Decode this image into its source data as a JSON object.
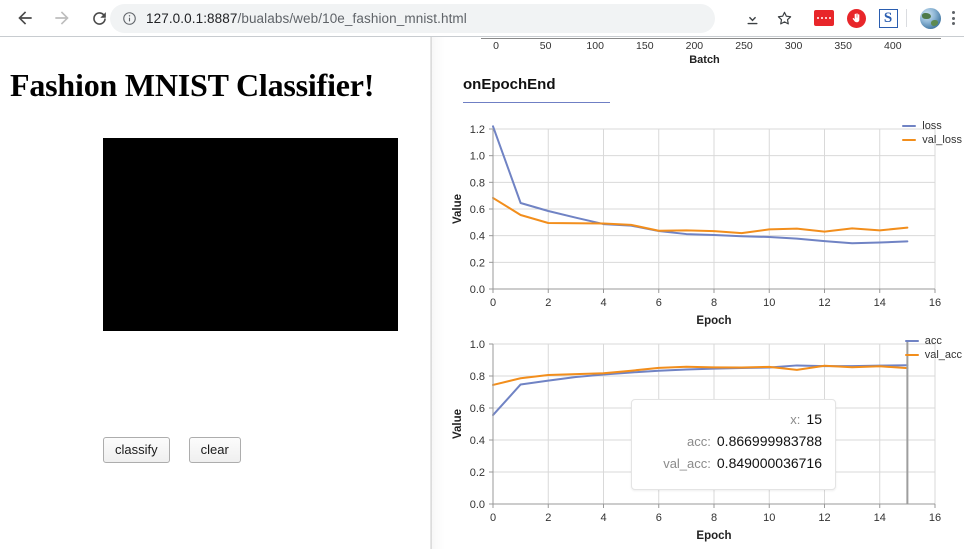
{
  "browser": {
    "back_label": "Back",
    "forward_label": "Forward",
    "reload_label": "Reload",
    "omnibox": {
      "host": "127.0.0.1:8887",
      "path": "/bualabs/web/10e_fashion_mnist.html",
      "info_icon": "info-circle-icon"
    },
    "toolbar_icons": [
      {
        "name": "download-icon",
        "label": "Downloads"
      },
      {
        "name": "star-icon",
        "label": "Bookmark this tab"
      },
      {
        "name": "extension-red-badge-icon",
        "label": "Extension"
      },
      {
        "name": "stop-hand-icon",
        "label": "Extension"
      },
      {
        "name": "blue-s-icon",
        "label": "Extension",
        "glyph": "S"
      },
      {
        "name": "avatar-globe-icon",
        "label": "Profile"
      },
      {
        "name": "kebab-menu-icon",
        "label": "Customize and control"
      }
    ]
  },
  "page": {
    "title": "Fashion MNIST Classifier!",
    "canvas_name": "drawing-canvas",
    "buttons": [
      {
        "name": "classify-button",
        "label": "classify"
      },
      {
        "name": "clear-button",
        "label": "clear"
      }
    ]
  },
  "visor": {
    "heading": "onEpochEnd",
    "batch_chart_partial": {
      "xlabel": "Batch",
      "ticks": [
        "0",
        "50",
        "100",
        "150",
        "200",
        "250",
        "300",
        "350",
        "400"
      ]
    },
    "tooltip": {
      "rows": [
        {
          "key": "x:",
          "value": "15"
        },
        {
          "key": "acc:",
          "value": "0.866999983788"
        },
        {
          "key": "val_acc:",
          "value": "0.849000036716"
        }
      ]
    }
  },
  "colors": {
    "series_blue": "#7083c4",
    "series_orange": "#f28e1c",
    "grid": "#d9d9d9",
    "axis": "#999999",
    "cursor_line": "#9e9e9e",
    "heading_underline": "#6f7fc4"
  },
  "chart_data": [
    {
      "type": "line",
      "name": "loss-chart",
      "title": "",
      "xlabel": "Epoch",
      "ylabel": "Value",
      "xlim": [
        0,
        16
      ],
      "ylim": [
        0.0,
        1.2
      ],
      "xticks": [
        0,
        2,
        4,
        6,
        8,
        10,
        12,
        14,
        16
      ],
      "yticks": [
        0.0,
        0.2,
        0.4,
        0.6,
        0.8,
        1.0,
        1.2
      ],
      "grid": true,
      "legend_position": "right",
      "x": [
        0,
        1,
        2,
        3,
        4,
        5,
        6,
        7,
        8,
        9,
        10,
        11,
        12,
        13,
        14,
        15
      ],
      "series": [
        {
          "name": "loss",
          "color": "#7083c4",
          "values": [
            1.22,
            0.645,
            0.585,
            0.535,
            0.487,
            0.475,
            0.435,
            0.412,
            0.405,
            0.396,
            0.39,
            0.378,
            0.359,
            0.343,
            0.349,
            0.357
          ]
        },
        {
          "name": "val_loss",
          "color": "#f28e1c",
          "values": [
            0.683,
            0.555,
            0.495,
            0.493,
            0.491,
            0.481,
            0.437,
            0.44,
            0.434,
            0.419,
            0.447,
            0.453,
            0.43,
            0.455,
            0.44,
            0.46
          ]
        }
      ]
    },
    {
      "type": "line",
      "name": "accuracy-chart",
      "title": "",
      "xlabel": "Epoch",
      "ylabel": "Value",
      "xlim": [
        0,
        16
      ],
      "ylim": [
        0.0,
        1.0
      ],
      "xticks": [
        0,
        2,
        4,
        6,
        8,
        10,
        12,
        14,
        16
      ],
      "yticks": [
        0.0,
        0.2,
        0.4,
        0.6,
        0.8,
        1.0
      ],
      "grid": true,
      "legend_position": "right",
      "cursor_x": 15,
      "x": [
        0,
        1,
        2,
        3,
        4,
        5,
        6,
        7,
        8,
        9,
        10,
        11,
        12,
        13,
        14,
        15
      ],
      "series": [
        {
          "name": "acc",
          "color": "#7083c4",
          "values": [
            0.556,
            0.747,
            0.771,
            0.794,
            0.809,
            0.822,
            0.833,
            0.841,
            0.846,
            0.85,
            0.853,
            0.866,
            0.862,
            0.862,
            0.865,
            0.867
          ]
        },
        {
          "name": "val_acc",
          "color": "#f28e1c",
          "values": [
            0.744,
            0.786,
            0.806,
            0.812,
            0.817,
            0.833,
            0.851,
            0.858,
            0.854,
            0.853,
            0.857,
            0.838,
            0.864,
            0.855,
            0.861,
            0.849
          ]
        }
      ]
    }
  ]
}
